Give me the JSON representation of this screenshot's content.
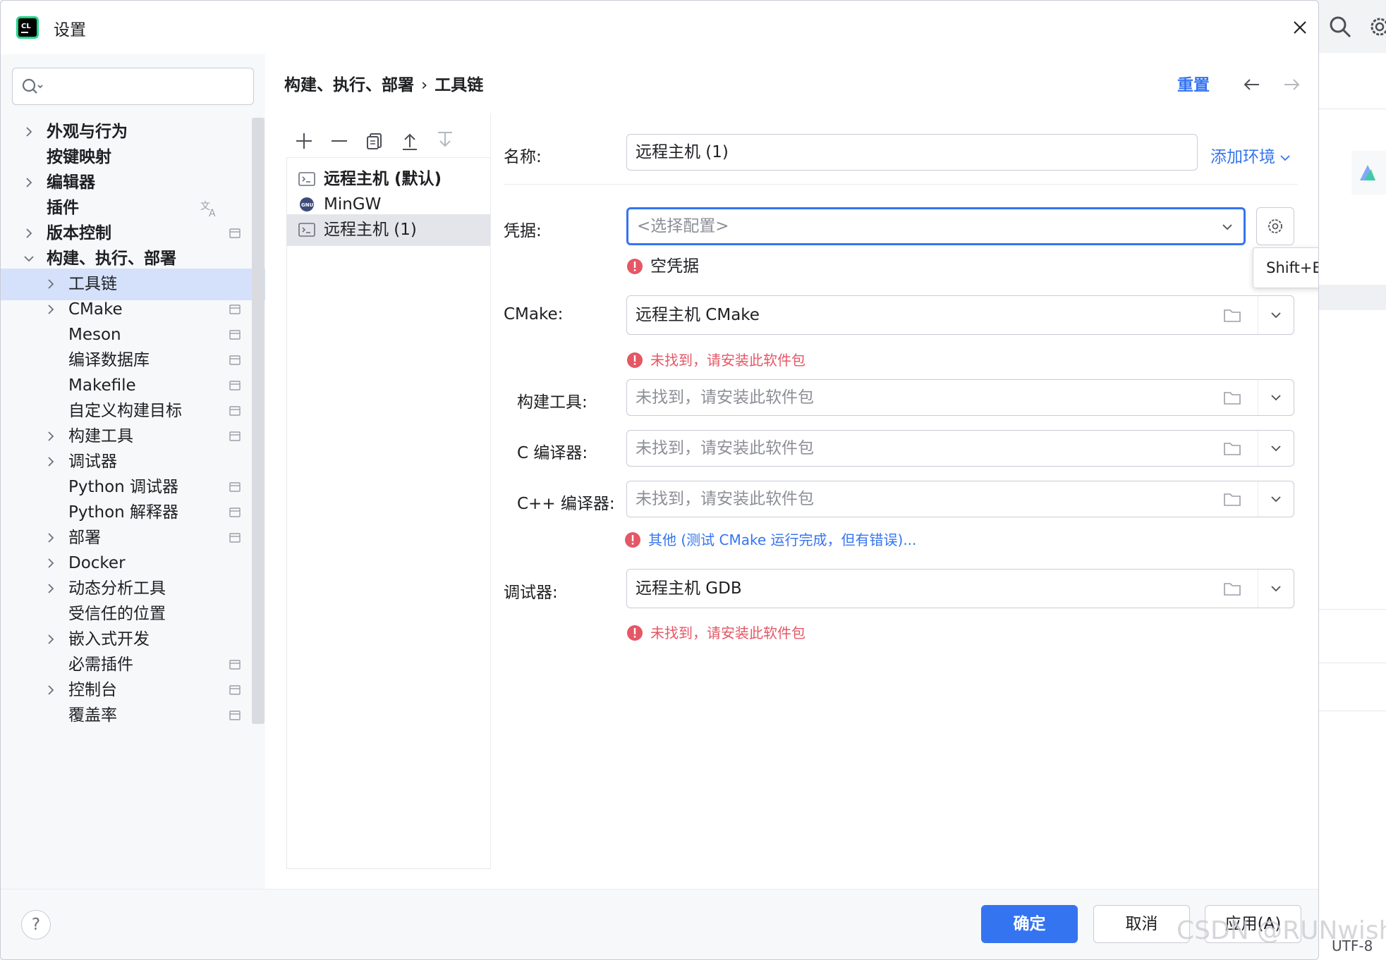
{
  "dialog": {
    "title": "设置",
    "close_icon": "close-icon"
  },
  "search": {
    "placeholder": ""
  },
  "nav": {
    "items": [
      {
        "label": "外观与行为",
        "expandable": true,
        "bold": true
      },
      {
        "label": "按键映射",
        "expandable": false,
        "bold": true
      },
      {
        "label": "编辑器",
        "expandable": true,
        "bold": true
      },
      {
        "label": "插件",
        "expandable": false,
        "bold": true
      },
      {
        "label": "版本控制",
        "expandable": true,
        "bold": true
      },
      {
        "label": "构建、执行、部署",
        "expandable": true,
        "expanded": true,
        "bold": true
      },
      {
        "label": "工具链",
        "expandable": true,
        "selected": true
      },
      {
        "label": "CMake",
        "expandable": true
      },
      {
        "label": "Meson",
        "expandable": false
      },
      {
        "label": "编译数据库",
        "expandable": false
      },
      {
        "label": "Makefile",
        "expandable": false
      },
      {
        "label": "自定义构建目标",
        "expandable": false
      },
      {
        "label": "构建工具",
        "expandable": true
      },
      {
        "label": "调试器",
        "expandable": true
      },
      {
        "label": "Python 调试器",
        "expandable": false
      },
      {
        "label": "Python 解释器",
        "expandable": false
      },
      {
        "label": "部署",
        "expandable": true
      },
      {
        "label": "Docker",
        "expandable": true
      },
      {
        "label": "动态分析工具",
        "expandable": true
      },
      {
        "label": "受信任的位置",
        "expandable": false
      },
      {
        "label": "嵌入式开发",
        "expandable": true
      },
      {
        "label": "必需插件",
        "expandable": false
      },
      {
        "label": "控制台",
        "expandable": true
      },
      {
        "label": "覆盖率",
        "expandable": false
      }
    ]
  },
  "breadcrumb": {
    "parent": "构建、执行、部署",
    "separator": "›",
    "current": "工具链"
  },
  "header": {
    "reset_label": "重置"
  },
  "toolchains": {
    "items": [
      {
        "label": "远程主机 (默认)",
        "icon": "remote-host-icon",
        "bold": true
      },
      {
        "label": "MinGW",
        "icon": "gnu-icon"
      },
      {
        "label": "远程主机 (1)",
        "icon": "remote-host-icon",
        "selected": true
      }
    ]
  },
  "form": {
    "name_label": "名称:",
    "name_value": "远程主机 (1)",
    "add_env_label": "添加环境",
    "credentials_label": "凭据:",
    "credentials_placeholder": "<选择配置>",
    "credentials_error": "空凭据",
    "tooltip": "Shift+Enter",
    "cmake_label": "CMake:",
    "cmake_value": "远程主机 CMake",
    "cmake_error": "未找到，请安装此软件包",
    "build_tool_label": "构建工具:",
    "build_tool_placeholder": "未找到，请安装此软件包",
    "c_compiler_label": "C 编译器:",
    "c_compiler_placeholder": "未找到，请安装此软件包",
    "cpp_compiler_label": "C++ 编译器:",
    "cpp_compiler_placeholder": "未找到，请安装此软件包",
    "other_message": "其他 (测试 CMake 运行完成，但有错误)...",
    "debugger_label": "调试器:",
    "debugger_value": "远程主机 GDB",
    "debugger_error": "未找到，请安装此软件包"
  },
  "footer": {
    "help_label": "?",
    "ok_label": "确定",
    "cancel_label": "取消",
    "apply_label": "应用(A)"
  },
  "background": {
    "status_text": "UTF-8",
    "watermark": "CSDN @RUNwish"
  },
  "colors": {
    "accent": "#3574f0",
    "error": "#e55765",
    "selection": "#d5e1fb"
  }
}
